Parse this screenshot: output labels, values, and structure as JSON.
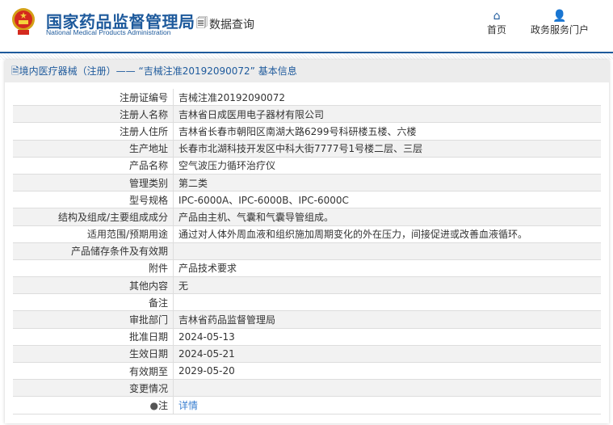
{
  "header": {
    "brand_cn": "国家药品监督管理局",
    "brand_en": "National Medical Products Administration",
    "query": "数据查询",
    "nav": [
      {
        "label": "首页",
        "icon": "home-icon"
      },
      {
        "label": "政务服务门户",
        "icon": "user-icon"
      }
    ]
  },
  "panel": {
    "title": "境内医疗器械（注册）—— “吉械注准20192090072” 基本信息"
  },
  "rows": [
    {
      "label": "注册证编号",
      "value": "吉械注准20192090072"
    },
    {
      "label": "注册人名称",
      "value": "吉林省日成医用电子器材有限公司"
    },
    {
      "label": "注册人住所",
      "value": "吉林省长春市朝阳区南湖大路6299号科研楼五楼、六楼"
    },
    {
      "label": "生产地址",
      "value": "长春市北湖科技开发区中科大街7777号1号楼二层、三层"
    },
    {
      "label": "产品名称",
      "value": "空气波压力循环治疗仪"
    },
    {
      "label": "管理类别",
      "value": "第二类"
    },
    {
      "label": "型号规格",
      "value": "IPC-6000A、IPC-6000B、IPC-6000C"
    },
    {
      "label": "结构及组成/主要组成成分",
      "value": "产品由主机、气囊和气囊导管组成。"
    },
    {
      "label": "适用范围/预期用途",
      "value": "通过对人体外周血液和组织施加周期变化的外在压力，间接促进或改善血液循环。"
    },
    {
      "label": "产品储存条件及有效期",
      "value": ""
    },
    {
      "label": "附件",
      "value": "产品技术要求"
    },
    {
      "label": "其他内容",
      "value": "无"
    },
    {
      "label": "备注",
      "value": ""
    },
    {
      "label": "审批部门",
      "value": "吉林省药品监督管理局"
    },
    {
      "label": "批准日期",
      "value": "2024-05-13"
    },
    {
      "label": "生效日期",
      "value": "2024-05-21"
    },
    {
      "label": "有效期至",
      "value": "2029-05-20"
    },
    {
      "label": "变更情况",
      "value": ""
    }
  ],
  "note": {
    "label": "注",
    "link": "详情"
  }
}
